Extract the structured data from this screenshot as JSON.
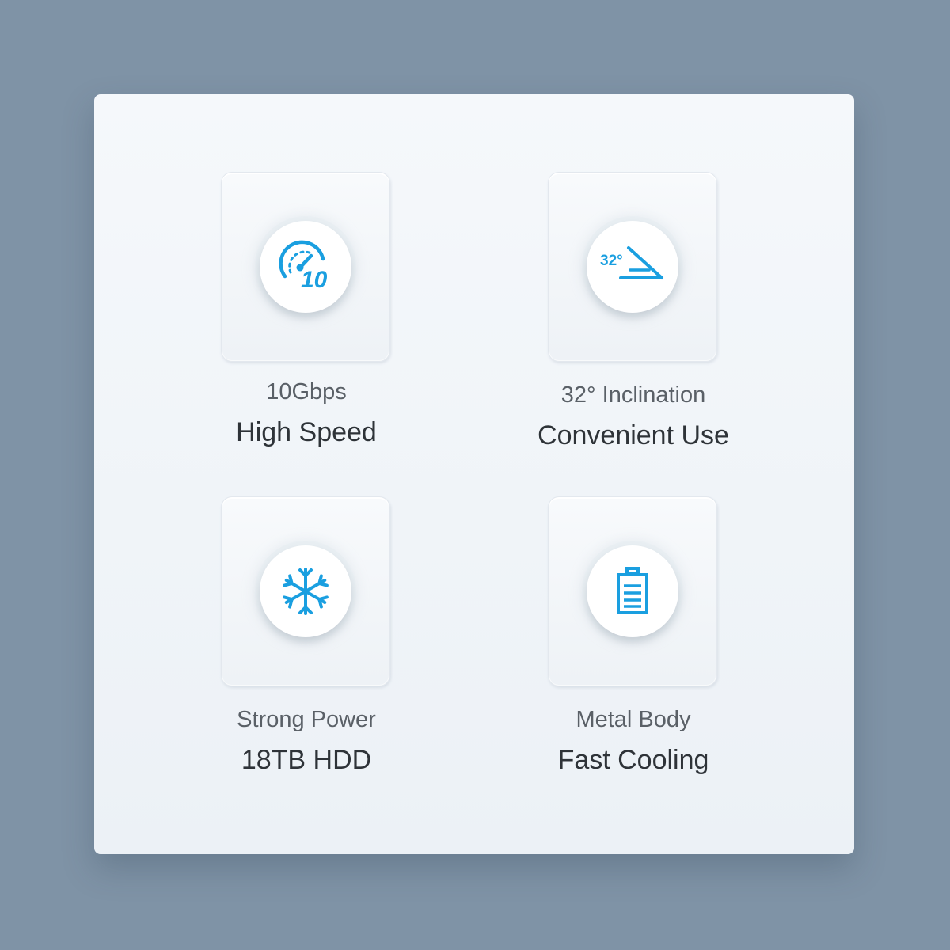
{
  "accent_color": "#1a9fe0",
  "features": [
    {
      "icon": "speedometer-10-icon",
      "icon_text": "10",
      "subtitle": "10Gbps",
      "title": "High Speed"
    },
    {
      "icon": "incline-angle-icon",
      "icon_text": "32°",
      "subtitle": "32° Inclination",
      "title": "Convenient Use"
    },
    {
      "icon": "snowflake-icon",
      "icon_text": "",
      "subtitle": "Strong Power",
      "title": "18TB HDD"
    },
    {
      "icon": "battery-icon",
      "icon_text": "",
      "subtitle": "Metal Body",
      "title": "Fast Cooling"
    }
  ]
}
